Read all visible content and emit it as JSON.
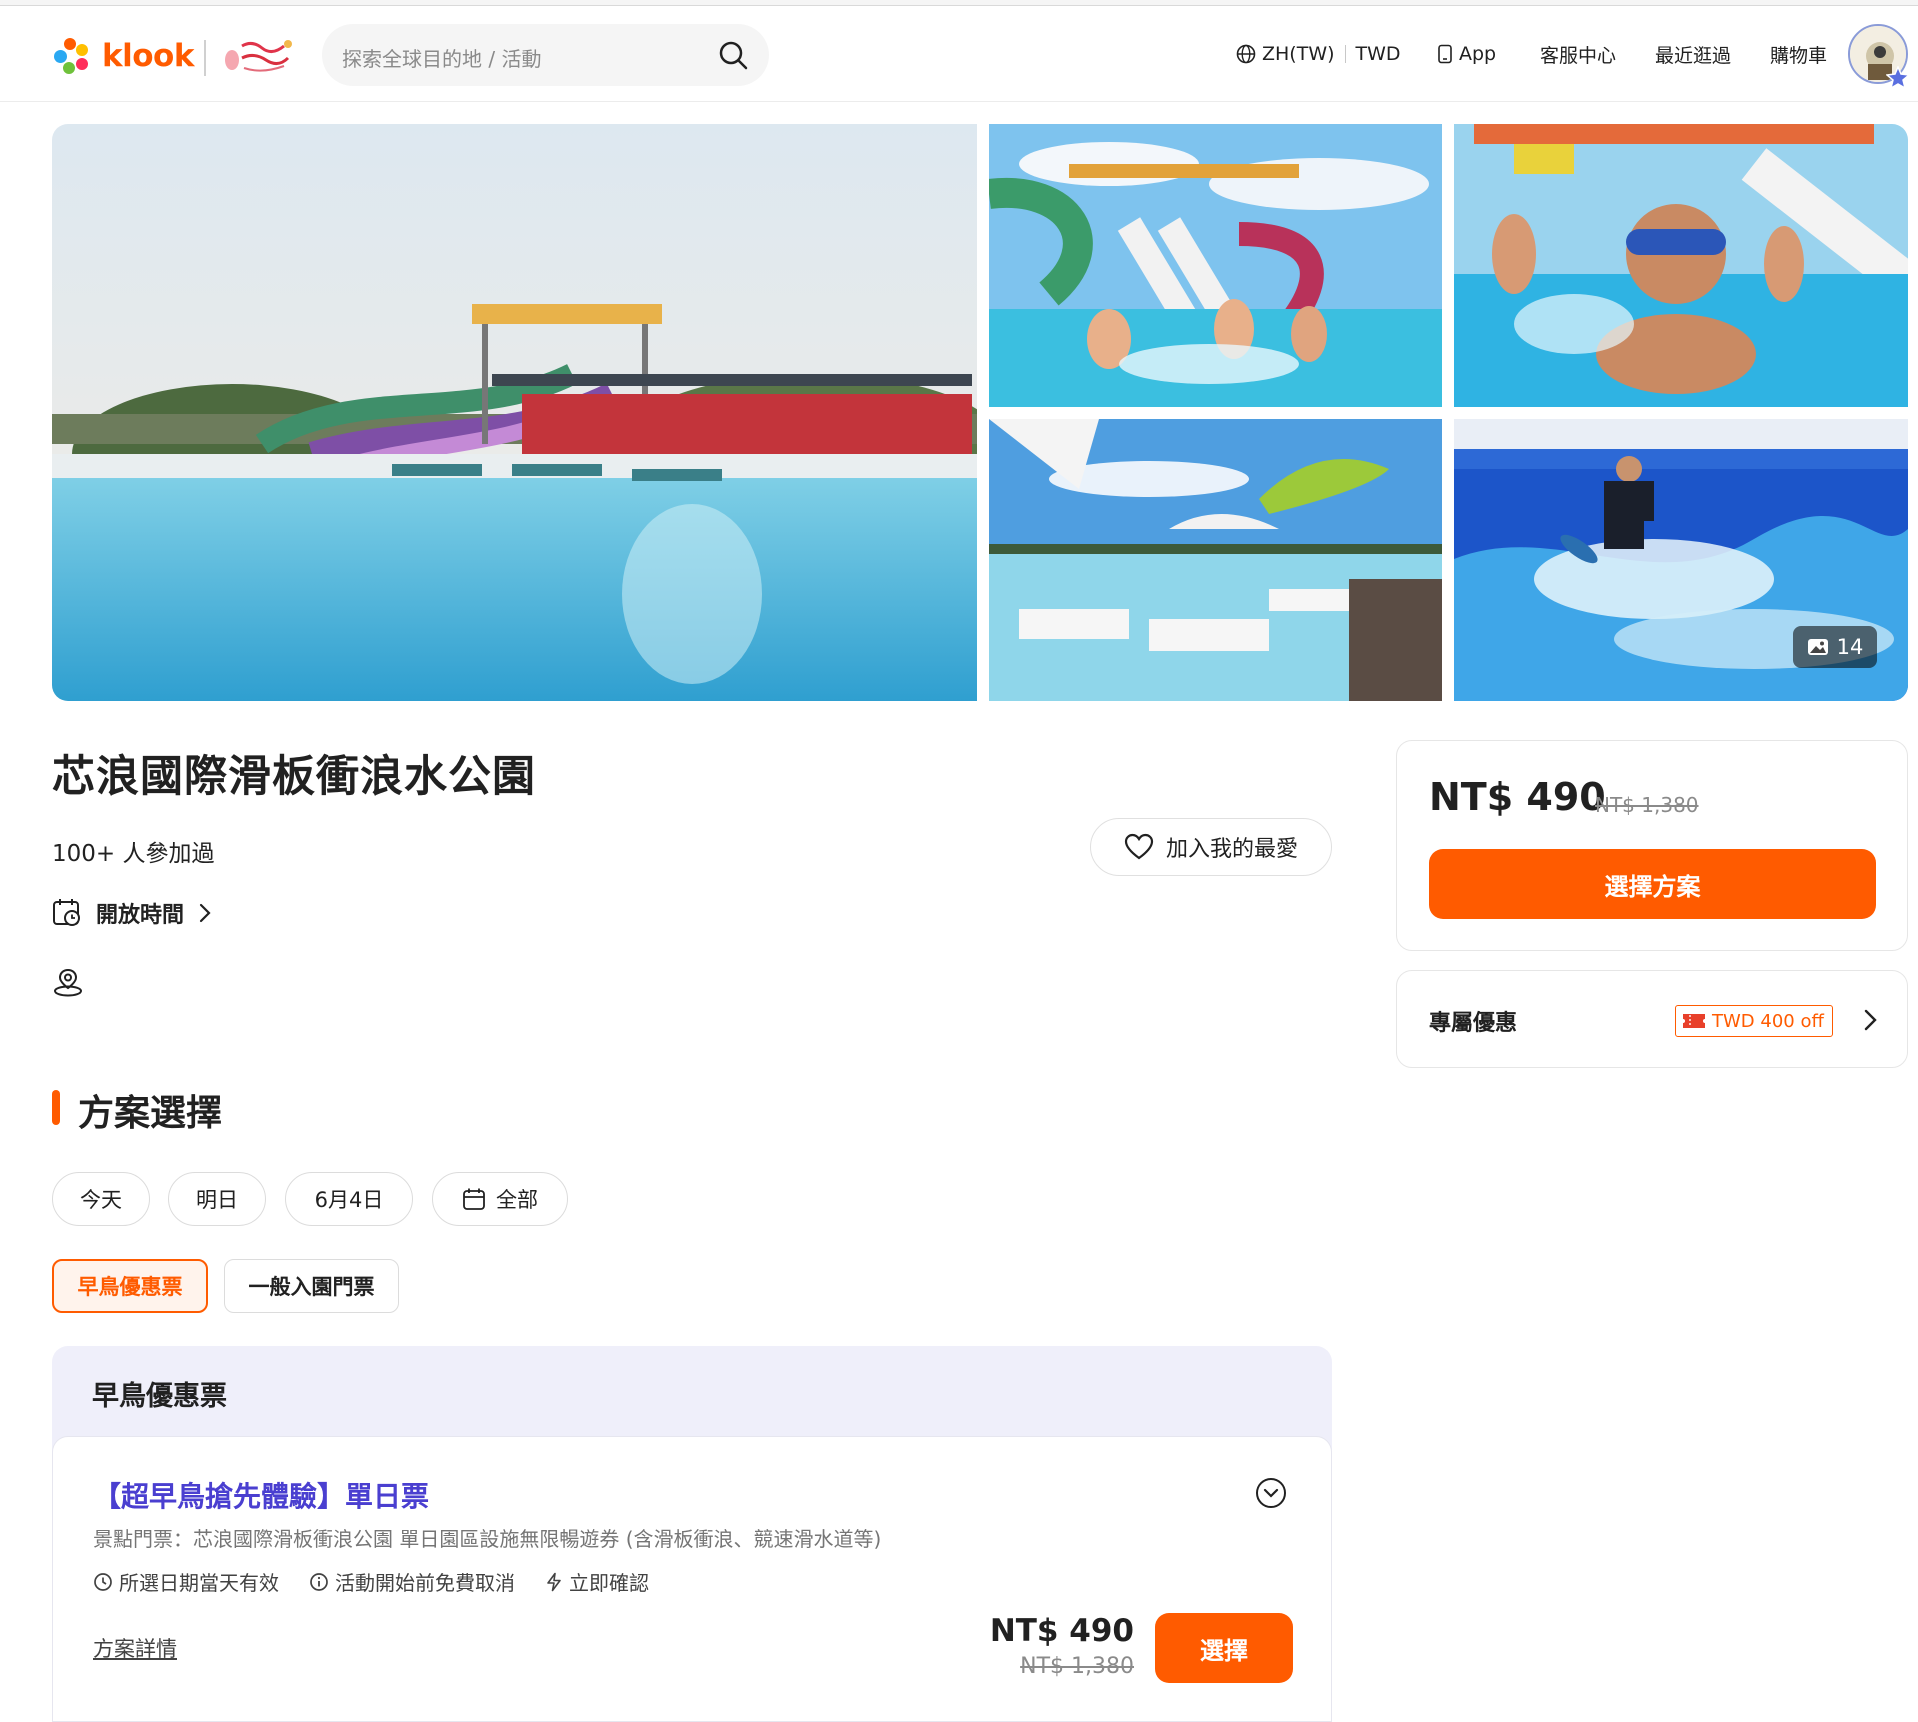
{
  "header": {
    "logo_text": "klook",
    "search_placeholder": "探索全球目的地 / 活動",
    "lang": "ZH(TW)",
    "currency": "TWD",
    "app_label": "App",
    "cs_label": "客服中心",
    "recent_label": "最近逛過",
    "cart_label": "購物車"
  },
  "gallery": {
    "photo_count": "14"
  },
  "activity": {
    "title": "芯浪國際滑板衝浪水公園",
    "participants": "100+ 人參加過",
    "wishlist_label": "加入我的最愛",
    "hours_label": "開放時間"
  },
  "packages": {
    "section_title": "方案選擇",
    "dates": [
      "今天",
      "明日",
      "6月4日",
      "全部"
    ],
    "types": [
      "早鳥優惠票",
      "一般入園門票"
    ],
    "group_title": "早鳥優惠票",
    "card": {
      "title": "【超早鳥搶先體驗】單日票",
      "description": "景點門票：芯浪國際滑板衝浪公園 單日園區設施無限暢遊券 (含滑板衝浪、競速滑水道等)",
      "features": [
        "所選日期當天有效",
        "活動開始前免費取消",
        "立即確認"
      ],
      "details_link": "方案詳情",
      "price": "NT$ 490",
      "original_price": "NT$ 1,380",
      "select_label": "選擇"
    }
  },
  "sidebar": {
    "price": "NT$ 490",
    "original_price": "NT$ 1,380",
    "button_label": "選擇方案",
    "deal_label": "專屬優惠",
    "coupon": "TWD 400 off"
  },
  "colors": {
    "brand": "#ff5b00",
    "card_title": "#4a3fd0",
    "group_bg": "#efeffa"
  }
}
